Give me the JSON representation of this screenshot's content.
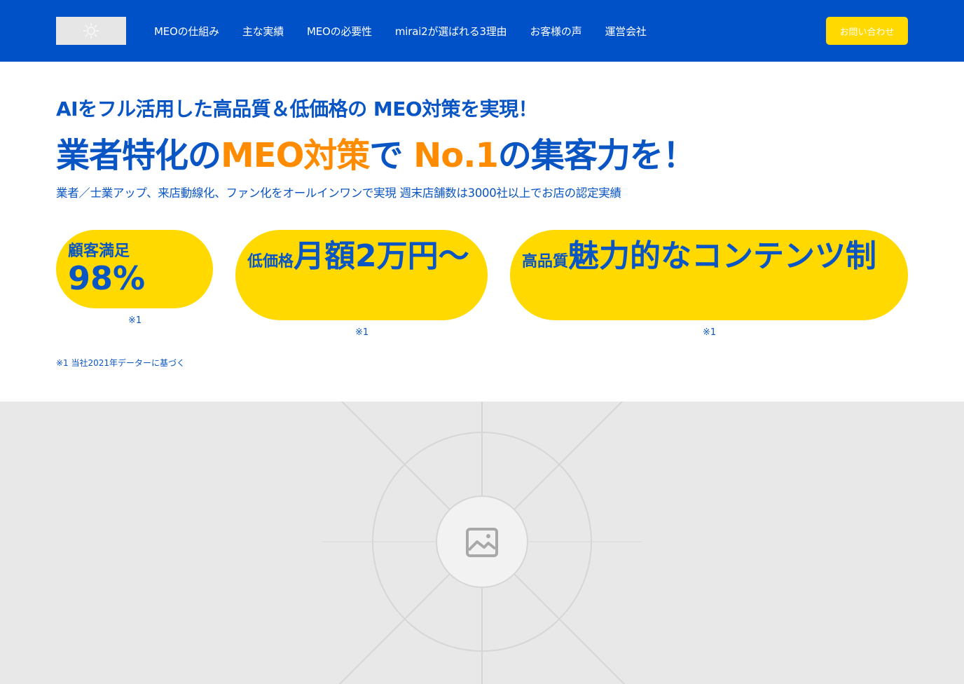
{
  "header": {
    "logo_icon": "logo-icon",
    "nav": [
      {
        "label": "MEOの仕組み"
      },
      {
        "label": "主な実績"
      },
      {
        "label": "MEOの必要性"
      },
      {
        "label": "mirai2が選ばれる3理由"
      },
      {
        "label": "お客様の声"
      },
      {
        "label": "運営会社"
      }
    ],
    "contact_label": "お問い合わせ"
  },
  "hero": {
    "subtitle": "AIをフル活用した高品質＆低価格の MEO対策を実現！",
    "title_part1": "業者特化の",
    "title_part2": "MEO対策",
    "title_part3": "で",
    "title_part4": "No.1",
    "title_part5": "の集客力を！",
    "description": "業者／士業アップ、来店動線化、ファン化をオールインワンで実現 週末店舗数は3000社以上でお店の認定実績"
  },
  "features": [
    {
      "small": "顧客満足",
      "big": "98%",
      "note": "※1"
    },
    {
      "small": "低価格",
      "big": "月額2万円〜",
      "note": "※1"
    },
    {
      "small": "高品質",
      "big": "魅力的なコンテンツ制",
      "note": "※1"
    }
  ],
  "footnote": "※1 当社2021年データーに基づく",
  "image_placeholder": {
    "icon": "image-icon"
  },
  "colors": {
    "header_bg": "#0050c8",
    "accent_yellow": "#ffd900",
    "text_blue": "#0a55c4",
    "accent_orange": "#ff8c00",
    "placeholder_bg": "#e8e8e8"
  }
}
